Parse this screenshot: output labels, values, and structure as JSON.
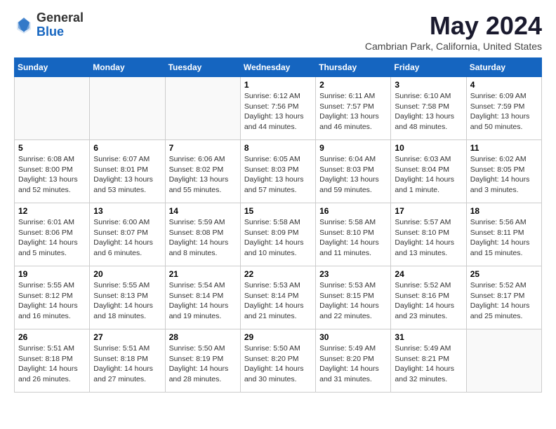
{
  "header": {
    "logo_general": "General",
    "logo_blue": "Blue",
    "month_title": "May 2024",
    "location": "Cambrian Park, California, United States"
  },
  "weekdays": [
    "Sunday",
    "Monday",
    "Tuesday",
    "Wednesday",
    "Thursday",
    "Friday",
    "Saturday"
  ],
  "weeks": [
    [
      {
        "day": "",
        "info": ""
      },
      {
        "day": "",
        "info": ""
      },
      {
        "day": "",
        "info": ""
      },
      {
        "day": "1",
        "info": "Sunrise: 6:12 AM\nSunset: 7:56 PM\nDaylight: 13 hours\nand 44 minutes."
      },
      {
        "day": "2",
        "info": "Sunrise: 6:11 AM\nSunset: 7:57 PM\nDaylight: 13 hours\nand 46 minutes."
      },
      {
        "day": "3",
        "info": "Sunrise: 6:10 AM\nSunset: 7:58 PM\nDaylight: 13 hours\nand 48 minutes."
      },
      {
        "day": "4",
        "info": "Sunrise: 6:09 AM\nSunset: 7:59 PM\nDaylight: 13 hours\nand 50 minutes."
      }
    ],
    [
      {
        "day": "5",
        "info": "Sunrise: 6:08 AM\nSunset: 8:00 PM\nDaylight: 13 hours\nand 52 minutes."
      },
      {
        "day": "6",
        "info": "Sunrise: 6:07 AM\nSunset: 8:01 PM\nDaylight: 13 hours\nand 53 minutes."
      },
      {
        "day": "7",
        "info": "Sunrise: 6:06 AM\nSunset: 8:02 PM\nDaylight: 13 hours\nand 55 minutes."
      },
      {
        "day": "8",
        "info": "Sunrise: 6:05 AM\nSunset: 8:03 PM\nDaylight: 13 hours\nand 57 minutes."
      },
      {
        "day": "9",
        "info": "Sunrise: 6:04 AM\nSunset: 8:03 PM\nDaylight: 13 hours\nand 59 minutes."
      },
      {
        "day": "10",
        "info": "Sunrise: 6:03 AM\nSunset: 8:04 PM\nDaylight: 14 hours\nand 1 minute."
      },
      {
        "day": "11",
        "info": "Sunrise: 6:02 AM\nSunset: 8:05 PM\nDaylight: 14 hours\nand 3 minutes."
      }
    ],
    [
      {
        "day": "12",
        "info": "Sunrise: 6:01 AM\nSunset: 8:06 PM\nDaylight: 14 hours\nand 5 minutes."
      },
      {
        "day": "13",
        "info": "Sunrise: 6:00 AM\nSunset: 8:07 PM\nDaylight: 14 hours\nand 6 minutes."
      },
      {
        "day": "14",
        "info": "Sunrise: 5:59 AM\nSunset: 8:08 PM\nDaylight: 14 hours\nand 8 minutes."
      },
      {
        "day": "15",
        "info": "Sunrise: 5:58 AM\nSunset: 8:09 PM\nDaylight: 14 hours\nand 10 minutes."
      },
      {
        "day": "16",
        "info": "Sunrise: 5:58 AM\nSunset: 8:10 PM\nDaylight: 14 hours\nand 11 minutes."
      },
      {
        "day": "17",
        "info": "Sunrise: 5:57 AM\nSunset: 8:10 PM\nDaylight: 14 hours\nand 13 minutes."
      },
      {
        "day": "18",
        "info": "Sunrise: 5:56 AM\nSunset: 8:11 PM\nDaylight: 14 hours\nand 15 minutes."
      }
    ],
    [
      {
        "day": "19",
        "info": "Sunrise: 5:55 AM\nSunset: 8:12 PM\nDaylight: 14 hours\nand 16 minutes."
      },
      {
        "day": "20",
        "info": "Sunrise: 5:55 AM\nSunset: 8:13 PM\nDaylight: 14 hours\nand 18 minutes."
      },
      {
        "day": "21",
        "info": "Sunrise: 5:54 AM\nSunset: 8:14 PM\nDaylight: 14 hours\nand 19 minutes."
      },
      {
        "day": "22",
        "info": "Sunrise: 5:53 AM\nSunset: 8:14 PM\nDaylight: 14 hours\nand 21 minutes."
      },
      {
        "day": "23",
        "info": "Sunrise: 5:53 AM\nSunset: 8:15 PM\nDaylight: 14 hours\nand 22 minutes."
      },
      {
        "day": "24",
        "info": "Sunrise: 5:52 AM\nSunset: 8:16 PM\nDaylight: 14 hours\nand 23 minutes."
      },
      {
        "day": "25",
        "info": "Sunrise: 5:52 AM\nSunset: 8:17 PM\nDaylight: 14 hours\nand 25 minutes."
      }
    ],
    [
      {
        "day": "26",
        "info": "Sunrise: 5:51 AM\nSunset: 8:18 PM\nDaylight: 14 hours\nand 26 minutes."
      },
      {
        "day": "27",
        "info": "Sunrise: 5:51 AM\nSunset: 8:18 PM\nDaylight: 14 hours\nand 27 minutes."
      },
      {
        "day": "28",
        "info": "Sunrise: 5:50 AM\nSunset: 8:19 PM\nDaylight: 14 hours\nand 28 minutes."
      },
      {
        "day": "29",
        "info": "Sunrise: 5:50 AM\nSunset: 8:20 PM\nDaylight: 14 hours\nand 30 minutes."
      },
      {
        "day": "30",
        "info": "Sunrise: 5:49 AM\nSunset: 8:20 PM\nDaylight: 14 hours\nand 31 minutes."
      },
      {
        "day": "31",
        "info": "Sunrise: 5:49 AM\nSunset: 8:21 PM\nDaylight: 14 hours\nand 32 minutes."
      },
      {
        "day": "",
        "info": ""
      }
    ]
  ]
}
